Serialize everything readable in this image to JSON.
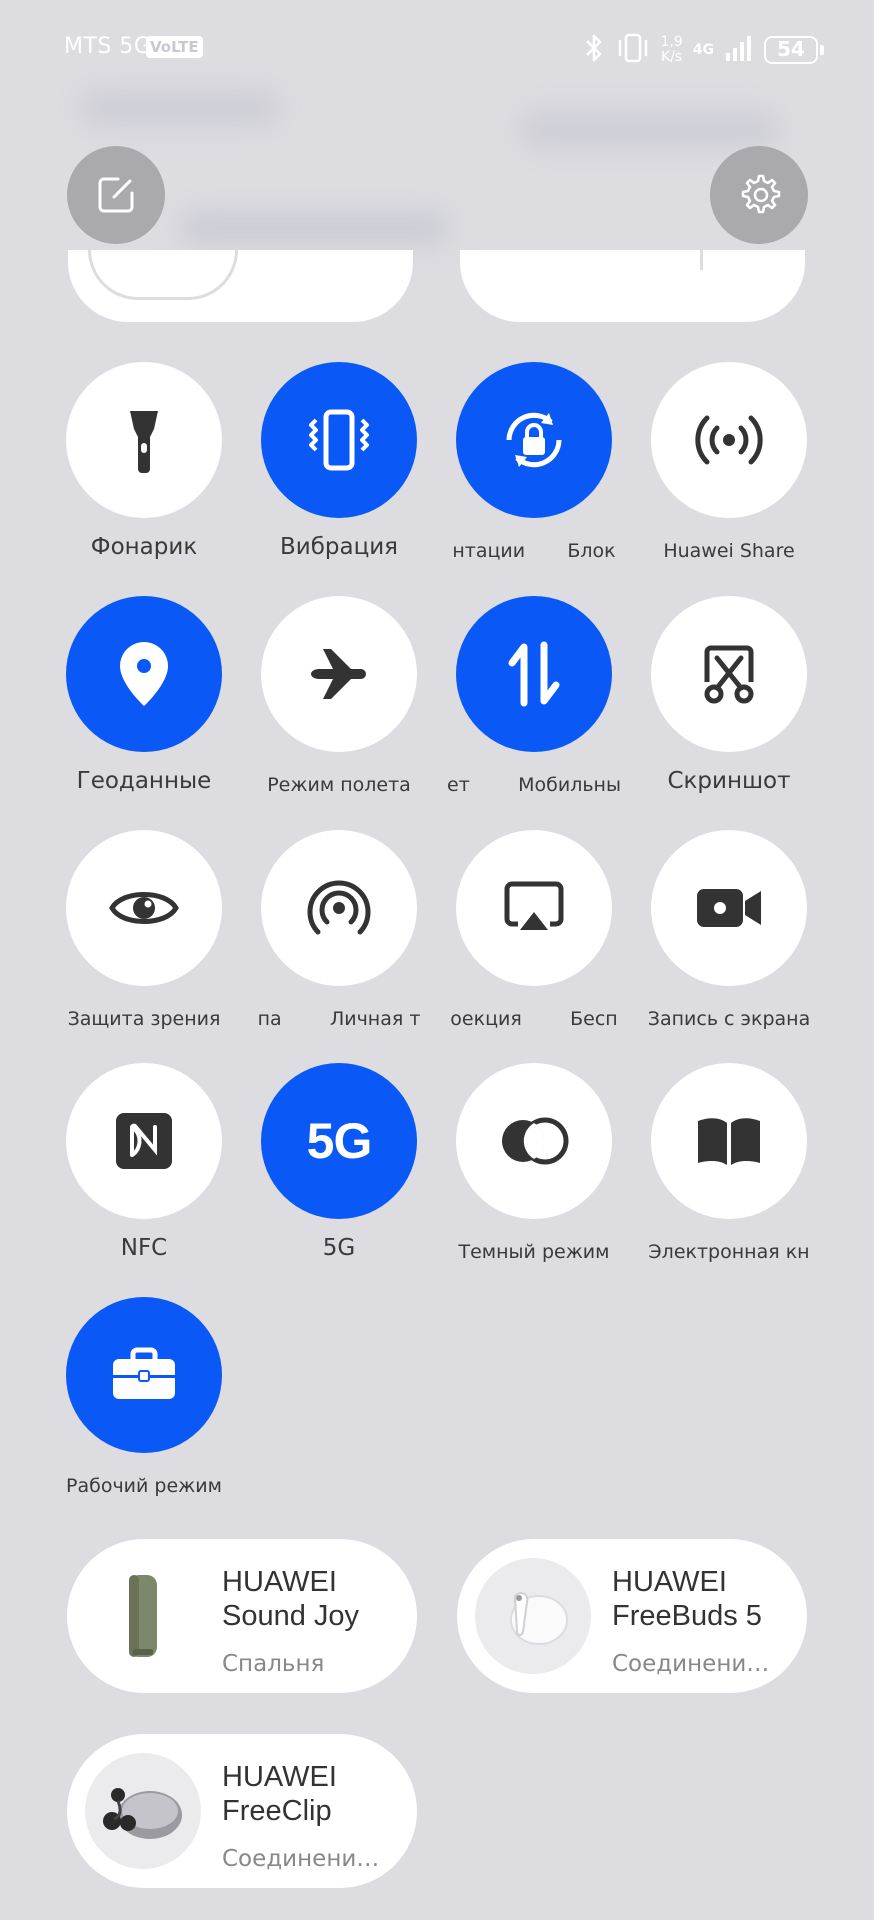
{
  "status_bar": {
    "carrier": "MTS 5G",
    "volte": "VoLTE",
    "speed_value": "1,9",
    "speed_unit": "K/s",
    "network": "4G",
    "battery": "54"
  },
  "tiles": [
    {
      "label": "Фонарик",
      "icon": "flashlight-icon",
      "active": false
    },
    {
      "label": "Вибрация",
      "icon": "vibration-icon",
      "active": true
    },
    {
      "label": "нтации       Блок",
      "icon": "rotation-lock-icon",
      "active": true
    },
    {
      "label": "Huawei Share",
      "icon": "huawei-share-icon",
      "active": false
    },
    {
      "label": "Геоданные",
      "icon": "location-icon",
      "active": true
    },
    {
      "label": "Режим полета",
      "icon": "airplane-icon",
      "active": false
    },
    {
      "label": "ет        Мобильны",
      "icon": "mobile-data-icon",
      "active": true
    },
    {
      "label": "Скриншот",
      "icon": "screenshot-icon",
      "active": false
    },
    {
      "label": "Защита зрения",
      "icon": "eye-icon",
      "active": false
    },
    {
      "label": "па        Личная т",
      "icon": "hotspot-icon",
      "active": false
    },
    {
      "label": "оекция        Бесп",
      "icon": "projection-icon",
      "active": false
    },
    {
      "label": "Запись с экрана",
      "icon": "screen-record-icon",
      "active": false
    },
    {
      "label": "NFC",
      "icon": "nfc-icon",
      "active": false
    },
    {
      "label": "5G",
      "icon": "5g-icon",
      "active": true,
      "glyph": "5G"
    },
    {
      "label": "Темный режим",
      "icon": "dark-mode-icon",
      "active": false
    },
    {
      "label": "Электронная кн",
      "icon": "ebook-icon",
      "active": false
    },
    {
      "label": "Рабочий режим",
      "icon": "briefcase-icon",
      "active": true
    }
  ],
  "devices": [
    {
      "name_line1": "HUAWEI",
      "name_line2": "Sound Joy",
      "status": "Спальня"
    },
    {
      "name_line1": "HUAWEI",
      "name_line2": "FreeBuds 5",
      "status": "Соединени…"
    },
    {
      "name_line1": "HUAWEI",
      "name_line2": "FreeClip",
      "status": "Соединени…"
    }
  ],
  "colors": {
    "accent": "#0a59f7",
    "background": "#dcdce1",
    "tile_off": "#ffffff"
  }
}
